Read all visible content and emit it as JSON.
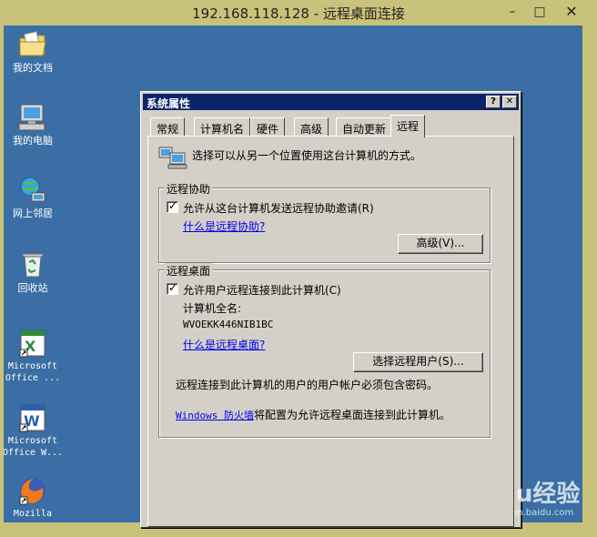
{
  "rdp": {
    "title": "192.168.118.128 - 远程桌面连接",
    "minimize": "–",
    "maximize": "□",
    "close": "✕"
  },
  "desktop": {
    "icons": [
      {
        "label": "我的文档",
        "icon": "folder-documents-icon"
      },
      {
        "label": "我的电脑",
        "icon": "computer-icon"
      },
      {
        "label": "网上邻居",
        "icon": "network-icon"
      },
      {
        "label": "回收站",
        "icon": "recycle-bin-icon"
      },
      {
        "label": "Microsoft Office ...",
        "icon": "excel-icon"
      },
      {
        "label": "Microsoft Office W...",
        "icon": "word-icon"
      },
      {
        "label": "Mozilla",
        "icon": "firefox-icon"
      }
    ]
  },
  "dialog": {
    "title": "系统属性",
    "help_btn": "?",
    "close_btn": "✕",
    "tabs": [
      {
        "label": "常规"
      },
      {
        "label": "计算机名"
      },
      {
        "label": "硬件"
      },
      {
        "label": "高级"
      },
      {
        "label": "自动更新"
      },
      {
        "label": "远程"
      }
    ],
    "intro": "选择可以从另一个位置使用这台计算机的方式。",
    "remote_assist": {
      "group_label": "远程协助",
      "checkbox_label": "允许从这台计算机发送远程协助邀请(R)",
      "checked": true,
      "link": "什么是远程协助?",
      "advanced_button": "高级(V)..."
    },
    "remote_desktop": {
      "group_label": "远程桌面",
      "checkbox_label": "允许用户远程连接到此计算机(C)",
      "checked": true,
      "computer_name_label": "计算机全名:",
      "computer_name": "WVOEKK446NIB1BC",
      "link": "什么是远程桌面?",
      "select_users_button": "选择远程用户(S)...",
      "password_note": "远程连接到此计算机的用户的用户帐户必须包含密码。",
      "firewall_link": "Windows 防火墙",
      "firewall_note": "将配置为允许远程桌面连接到此计算机。"
    }
  },
  "watermark": {
    "brand": "Baidu经验",
    "sub": "jingyan.baidu.com"
  },
  "colors": {
    "desktop": "#3a6ea5",
    "dialog_title": "#0a246a",
    "window_face": "#d4d0c8",
    "rdp_frame": "#c9c27a",
    "link": "#0000ee"
  }
}
